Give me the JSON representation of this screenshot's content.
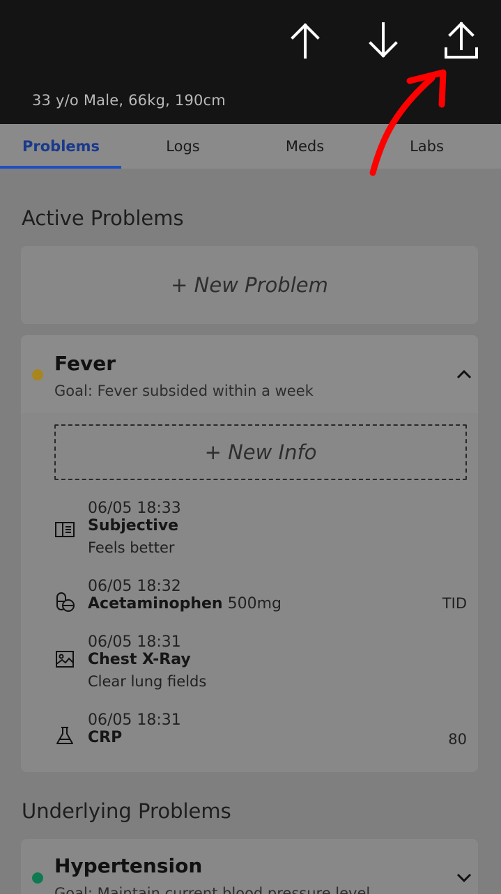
{
  "header": {
    "patient_info": "33 y/o Male, 66kg, 190cm",
    "icons": [
      "arrow-up-icon",
      "arrow-down-icon",
      "upload-icon"
    ]
  },
  "tabs": [
    {
      "label": "Problems",
      "active": true
    },
    {
      "label": "Logs",
      "active": false
    },
    {
      "label": "Meds",
      "active": false
    },
    {
      "label": "Labs",
      "active": false
    }
  ],
  "active_problems": {
    "title": "Active Problems",
    "new_problem_label": "+ New Problem",
    "problems": [
      {
        "name": "Fever",
        "goal": "Goal: Fever subsided within a week",
        "status_color": "#a8861d",
        "expanded": true,
        "new_info_label": "+ New Info",
        "entries": [
          {
            "icon": "note-icon",
            "time": "06/05 18:33",
            "title": "Subjective",
            "extra": "",
            "desc": "Feels better",
            "right": ""
          },
          {
            "icon": "pill-icon",
            "time": "06/05 18:32",
            "title": "Acetaminophen",
            "extra": " 500mg",
            "desc": "",
            "right": "TID"
          },
          {
            "icon": "image-icon",
            "time": "06/05 18:31",
            "title": "Chest X-Ray",
            "extra": "",
            "desc": "Clear lung fields",
            "right": ""
          },
          {
            "icon": "flask-icon",
            "time": "06/05 18:31",
            "title": "CRP",
            "extra": "",
            "desc": "",
            "right": "80"
          }
        ]
      }
    ]
  },
  "underlying_problems": {
    "title": "Underlying Problems",
    "problems": [
      {
        "name": "Hypertension",
        "goal": "Goal: Maintain current blood pressure level",
        "status_color": "#0f7a52",
        "expanded": false
      }
    ]
  },
  "colors": {
    "accent": "#1f4fbf",
    "header_bg": "#141414",
    "annotation": "#ff0000"
  }
}
